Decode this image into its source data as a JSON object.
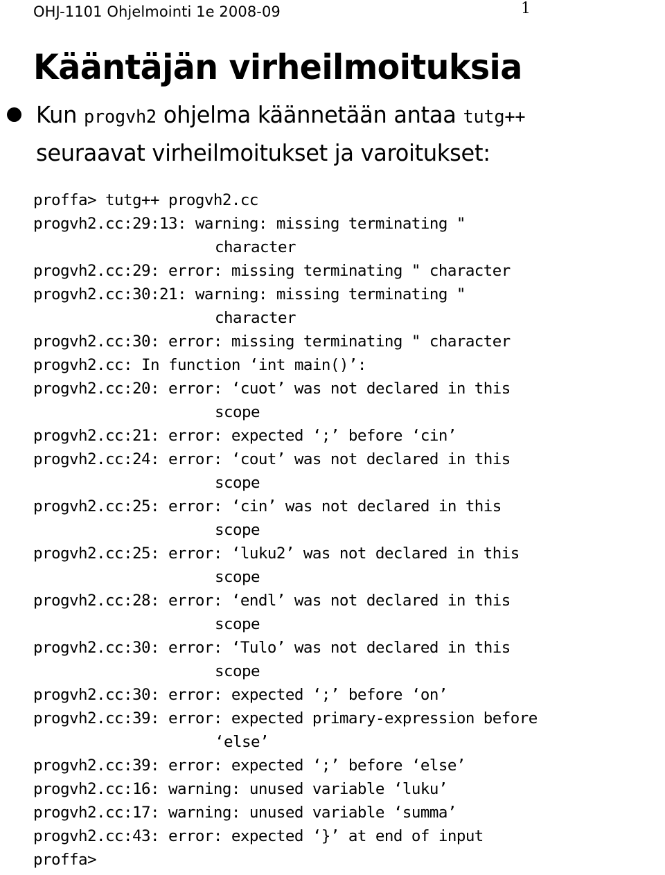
{
  "header": {
    "course": "OHJ-1101 Ohjelmointi 1e 2008-09",
    "page_number": "1"
  },
  "title": "Kääntäjän virheilmoituksia",
  "bullet": {
    "marker": "filled-disc",
    "part1": "Kun ",
    "code1": "progvh2",
    "part2": " ohjelma käännetään antaa ",
    "code2": "tutg++",
    "part3": " seuraavat virheilmoitukset ja varoitukset:"
  },
  "terminal": {
    "lines": [
      {
        "text": "proffa> tutg++ progvh2.cc",
        "continuation": false
      },
      {
        "text": "progvh2.cc:29:13: warning: missing terminating \"",
        "continuation": false
      },
      {
        "text": "character",
        "continuation": true
      },
      {
        "text": "progvh2.cc:29: error: missing terminating \" character",
        "continuation": false
      },
      {
        "text": "progvh2.cc:30:21: warning: missing terminating \"",
        "continuation": false
      },
      {
        "text": "character",
        "continuation": true
      },
      {
        "text": "progvh2.cc:30: error: missing terminating \" character",
        "continuation": false
      },
      {
        "text": "progvh2.cc: In function ‘int main()’:",
        "continuation": false
      },
      {
        "text": "progvh2.cc:20: error: ‘cuot’ was not declared in this",
        "continuation": false
      },
      {
        "text": "scope",
        "continuation": true
      },
      {
        "text": "progvh2.cc:21: error: expected ‘;’ before ‘cin’",
        "continuation": false
      },
      {
        "text": "progvh2.cc:24: error: ‘cout’ was not declared in this",
        "continuation": false
      },
      {
        "text": "scope",
        "continuation": true
      },
      {
        "text": "progvh2.cc:25: error: ‘cin’ was not declared in this",
        "continuation": false
      },
      {
        "text": "scope",
        "continuation": true
      },
      {
        "text": "progvh2.cc:25: error: ‘luku2’ was not declared in this",
        "continuation": false
      },
      {
        "text": "scope",
        "continuation": true
      },
      {
        "text": "progvh2.cc:28: error: ‘endl’ was not declared in this",
        "continuation": false
      },
      {
        "text": "scope",
        "continuation": true
      },
      {
        "text": "progvh2.cc:30: error: ‘Tulo’ was not declared in this",
        "continuation": false
      },
      {
        "text": "scope",
        "continuation": true
      },
      {
        "text": "progvh2.cc:30: error: expected ‘;’ before ‘on’",
        "continuation": false
      },
      {
        "text": "progvh2.cc:39: error: expected primary-expression before",
        "continuation": false
      },
      {
        "text": "‘else’",
        "continuation": true
      },
      {
        "text": "progvh2.cc:39: error: expected ‘;’ before ‘else’",
        "continuation": false
      },
      {
        "text": "progvh2.cc:16: warning: unused variable ‘luku’",
        "continuation": false
      },
      {
        "text": "progvh2.cc:17: warning: unused variable ‘summa’",
        "continuation": false
      },
      {
        "text": "progvh2.cc:43: error: expected ‘}’ at end of input",
        "continuation": false
      },
      {
        "text": "proffa>",
        "continuation": false
      }
    ]
  },
  "colors": {
    "text": "#000000",
    "background": "#ffffff"
  }
}
